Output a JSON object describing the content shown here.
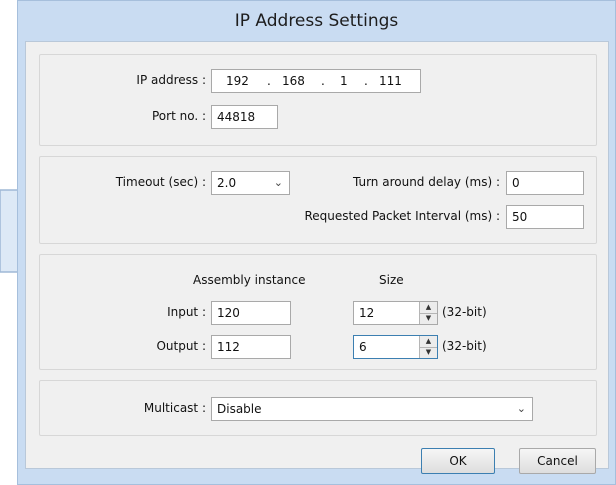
{
  "dialog": {
    "title": "IP Address Settings"
  },
  "ip_group": {
    "ip_label": "IP address :",
    "ip_octets": [
      "192",
      "168",
      "1",
      "111"
    ],
    "ip_dot": ".",
    "port_label": "Port no. :",
    "port_value": "44818"
  },
  "timing_group": {
    "timeout_label": "Timeout (sec) :",
    "timeout_value": "2.0",
    "turnaround_label": "Turn around delay (ms) :",
    "turnaround_value": "0",
    "rpi_label": "Requested Packet Interval (ms) :",
    "rpi_value": "50"
  },
  "assembly_group": {
    "col_instance": "Assembly instance",
    "col_size": "Size",
    "input_label": "Input :",
    "input_instance": "120",
    "input_size": "12",
    "input_unit": "(32-bit)",
    "output_label": "Output :",
    "output_instance": "112",
    "output_size": "6",
    "output_unit": "(32-bit)"
  },
  "multicast_group": {
    "label": "Multicast :",
    "value": "Disable"
  },
  "buttons": {
    "ok": "OK",
    "cancel": "Cancel"
  },
  "icons": {
    "dropdown": "chevron-down-icon",
    "spin_up": "triangle-up-icon",
    "spin_down": "triangle-down-icon",
    "pointer": "arrow-right-icon"
  }
}
